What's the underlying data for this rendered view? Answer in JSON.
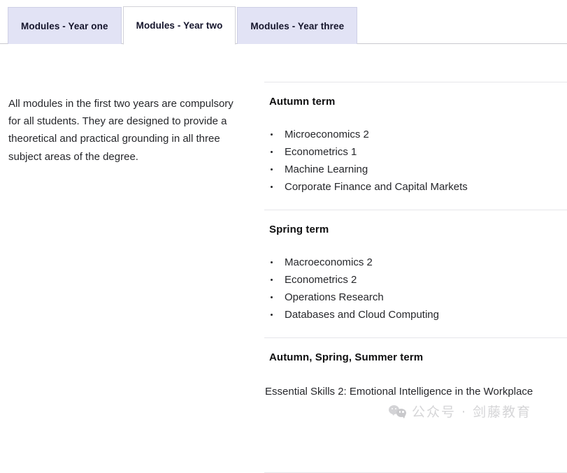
{
  "tabs": [
    {
      "label": "Modules - Year one",
      "active": false
    },
    {
      "label": "Modules - Year two",
      "active": true
    },
    {
      "label": "Modules - Year three",
      "active": false
    }
  ],
  "intro": {
    "text": "All modules in the first two years are compulsory for all students. They are designed to provide a theoretical and practical grounding in all three subject areas of the degree."
  },
  "terms": [
    {
      "title": "Autumn term",
      "modules": [
        "Microeconomics 2",
        "Econometrics 1",
        "Machine Learning",
        "Corporate Finance and Capital Markets"
      ]
    },
    {
      "title": "Spring term",
      "modules": [
        "Macroeconomics 2",
        "Econometrics 2",
        "Operations Research",
        "Databases and Cloud Computing"
      ]
    },
    {
      "title": "Autumn, Spring, Summer term",
      "note": "Essential Skills 2: Emotional Intelligence in the Workplace"
    }
  ],
  "watermark": {
    "icon": "wechat-logo-icon",
    "text": "公众号 · 剑藤教育"
  },
  "colors": {
    "tab_inactive_bg": "#e2e3f5",
    "tab_active_bg": "#ffffff",
    "tab_border": "#cfd0e6",
    "rule": "#c9c9cf",
    "divider": "#e6e6ea",
    "text": "#26272b",
    "heading": "#0f0f10",
    "watermark": "#bcbcc0"
  }
}
